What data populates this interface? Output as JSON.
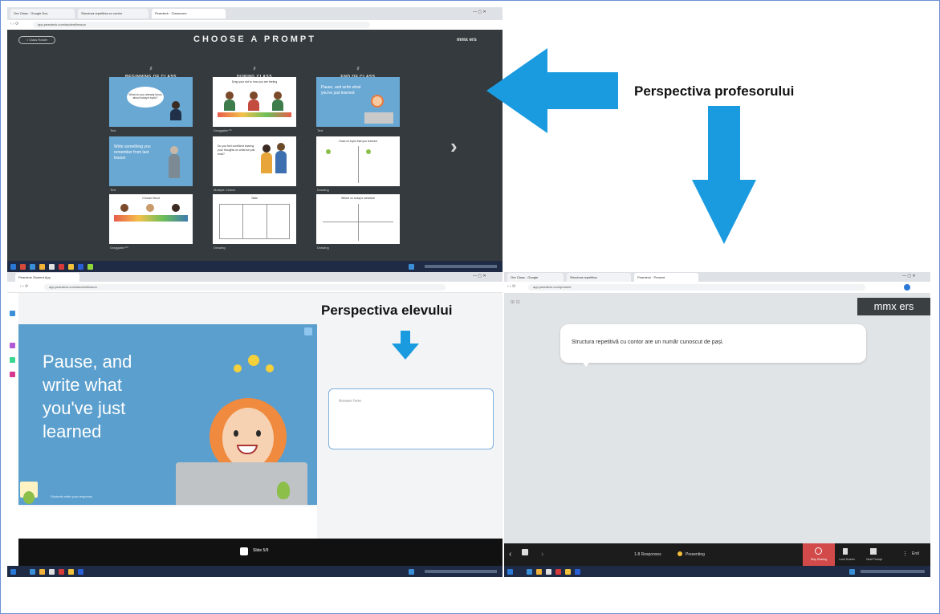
{
  "teacher": {
    "title": "CHOOSE A PROMPT",
    "back_button": "< Class Roster",
    "brand": "mmx ers",
    "columns": [
      {
        "title": "BEGINNING OF CLASS",
        "icon": "♯"
      },
      {
        "title": "DURING CLASS",
        "icon": "♯"
      },
      {
        "title": "END OF CLASS",
        "icon": "♯"
      }
    ],
    "cards": [
      {
        "label": "Text",
        "text": "What do you already know about today's topic?"
      },
      {
        "label": "Draggable™",
        "text": "Drag your dot to how you are feeling"
      },
      {
        "label": "Text",
        "text": "Pause, and write what you've just learned"
      },
      {
        "label": "Text",
        "text": "Write something you remember from last lesson"
      },
      {
        "label": "Multiple Choice",
        "text": "Do you feel confident sharing your thoughts on what we just read?"
      },
      {
        "label": "Drawing",
        "text": "Draw on topic that you learned"
      },
      {
        "label": "Draggable™",
        "text": "Choose Mood"
      },
      {
        "label": "Drawing",
        "text": "Table"
      },
      {
        "label": "Drawing",
        "text": "Where on today's schedule"
      }
    ],
    "next_icon": "›"
  },
  "student": {
    "slide_text": [
      "Pause, and",
      "write what",
      "you've just",
      "learned"
    ],
    "footer_text": "Students write your response",
    "answer_placeholder": "Answer here",
    "zoom_badge": "Slide 5/9"
  },
  "zoom": {
    "bubble_text": "Structura repetitivă cu contor are un număr cunoscut de pași.",
    "brand": "mmx ers",
    "participants": "1-8 Responses",
    "status": "Presenting",
    "stop_label": "Stop Sharing",
    "btn1": "Lock Screen",
    "btn2": "Next Prompt",
    "end": "End"
  },
  "labels": {
    "teacher": "Perspectiva profesorului",
    "student": "Perspectiva elevului"
  },
  "colors": {
    "arrow": "#1a9be0",
    "teacher_bg": "#343a3d",
    "slide_blue": "#5b9fce"
  }
}
